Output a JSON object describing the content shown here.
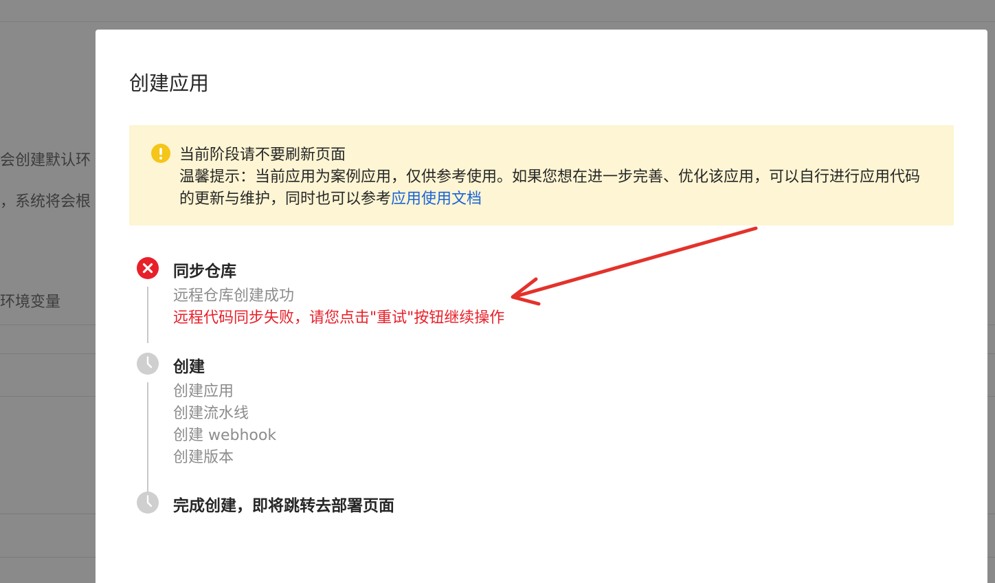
{
  "background": {
    "text_1": "会创建默认环",
    "text_2": "，系统将会根",
    "text_3": "环境变量"
  },
  "modal": {
    "title": "创建应用",
    "alert": {
      "icon": "warning-circle-icon",
      "color": "#fdf5d3",
      "line_1": "当前阶段请不要刷新页面",
      "line_2": "温馨提示：当前应用为案例应用，仅供参考使用。如果您想在进一步完善、优化该应用，可以自行进行应用代码的更新与维护，同时也可以参考",
      "link": "应用使用文档"
    },
    "steps": [
      {
        "status": "error",
        "icon": "error-x-circle-icon",
        "title": "同步仓库",
        "messages": [
          "远程仓库创建成功"
        ],
        "error": "远程代码同步失败，请您点击\"重试\"按钮继续操作"
      },
      {
        "status": "waiting",
        "icon": "clock-icon",
        "title": "创建",
        "messages": [
          "创建应用",
          "创建流水线",
          "创建 webhook",
          "创建版本"
        ]
      },
      {
        "status": "waiting",
        "icon": "clock-icon",
        "title": "完成创建，即将跳转去部署页面",
        "messages": []
      }
    ]
  },
  "colors": {
    "error": "#e8202a",
    "link": "#1a63d8",
    "warning": "#f5c518",
    "waiting": "#cfcfcf",
    "annotation_arrow": "#e3322b"
  }
}
